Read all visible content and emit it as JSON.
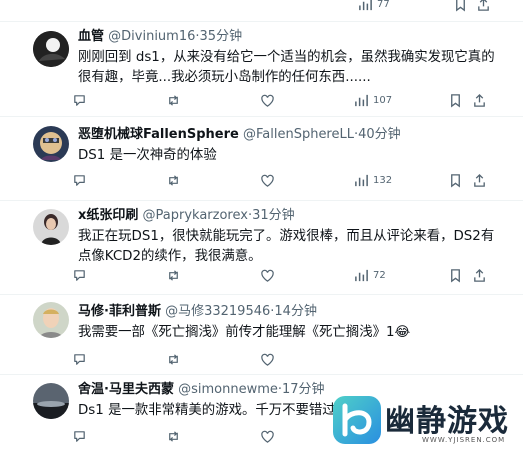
{
  "tweets": [
    {
      "name": "血管",
      "handle": "@Divinium16",
      "time": "35分钟",
      "text": "刚刚回到 ds1，从来没有给它一个适当的机会，虽然我确实发现它真的很有趣，毕竟...我必须玩小岛制作的任何东西......",
      "views": "107"
    },
    {
      "name": "恶堕机械球FallenSphere",
      "handle": "@FallenSphereLL",
      "time": "40分钟",
      "text": "DS1 是一次神奇的体验",
      "views": "132"
    },
    {
      "name": "x纸张印刷",
      "handle": "@Paprykarzorex",
      "time": "31分钟",
      "text": "我正在玩DS1，很快就能玩完了。游戏很棒，而且从评论来看，DS2有点像KCD2的续作，我很满意。",
      "views": "72"
    },
    {
      "name": "马修·菲利普斯",
      "handle": "@马修33219546",
      "time": "14分钟",
      "text": "我需要一部《死亡搁浅》前传才能理解《死亡搁浅》1😂",
      "views": ""
    },
    {
      "name": "舍温·马里夫西蒙",
      "handle": "@simonnewme",
      "time": "17分钟",
      "text": "Ds1 是一款非常精美的游戏。千万不要错过。",
      "views": ""
    }
  ],
  "separator": "·",
  "top_strip": {
    "count": "77"
  },
  "watermark": {
    "text": "幽静游戏",
    "url": "WWW.YJISREN.COM"
  },
  "colors": {
    "text": "#0f1419",
    "muted": "#536471",
    "divider": "#eff3f4",
    "accent": "#1d9bf0"
  },
  "icons": [
    "reply-icon",
    "retweet-icon",
    "like-icon",
    "views-icon",
    "bookmark-icon",
    "share-icon"
  ]
}
